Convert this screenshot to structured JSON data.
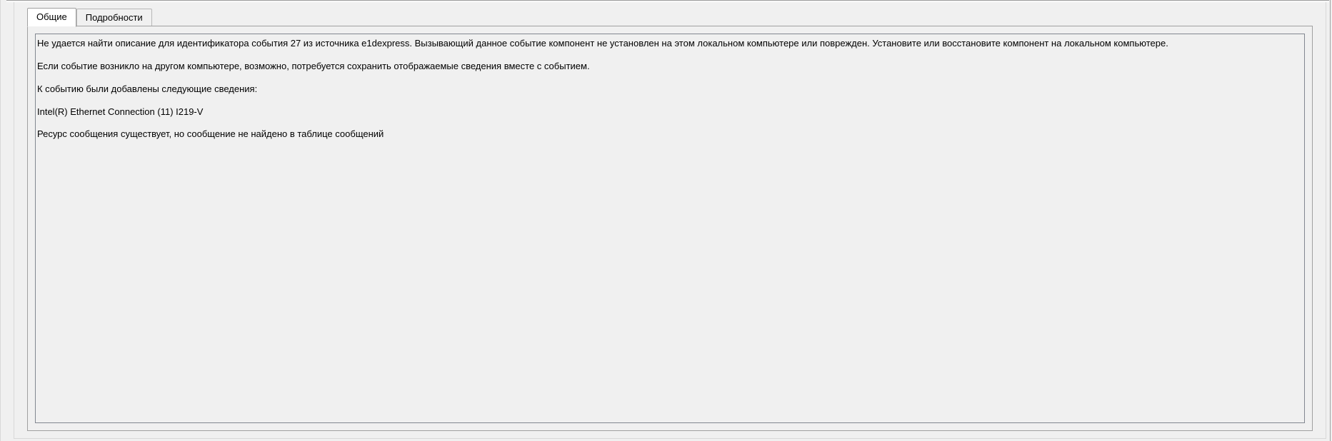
{
  "tabs": {
    "general": "Общие",
    "details": "Подробности"
  },
  "event": {
    "paragraphs": [
      "Не удается найти описание для идентификатора события 27 из источника e1dexpress. Вызывающий данное событие компонент не установлен на этом локальном компьютере или поврежден. Установите или восстановите компонент на локальном компьютере.",
      "Если событие возникло на другом компьютере, возможно, потребуется сохранить отображаемые сведения вместе с событием.",
      "К событию были добавлены следующие сведения:",
      "Intel(R) Ethernet Connection (11) I219-V",
      "Ресурс сообщения существует, но сообщение не найдено в таблице сообщений"
    ]
  }
}
